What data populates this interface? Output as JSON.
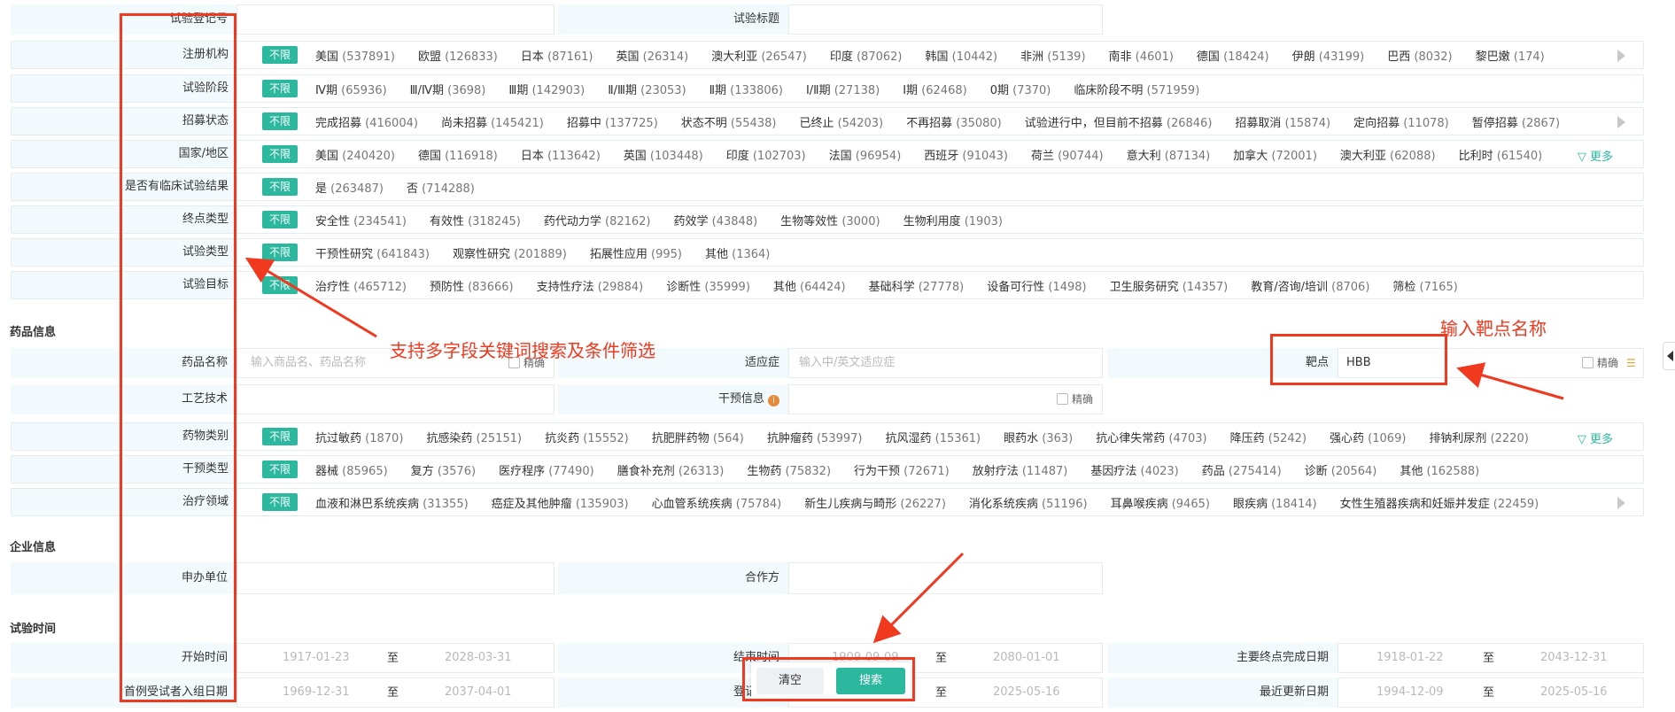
{
  "rows": {
    "reg_no": {
      "label": "试验登记号"
    },
    "trial_title": {
      "label": "试验标题"
    },
    "registry": {
      "label": "注册机构",
      "all": "不限",
      "options": [
        [
          "美国",
          "(537891)"
        ],
        [
          "欧盟",
          "(126833)"
        ],
        [
          "日本",
          "(87161)"
        ],
        [
          "英国",
          "(26314)"
        ],
        [
          "澳大利亚",
          "(26547)"
        ],
        [
          "印度",
          "(87062)"
        ],
        [
          "韩国",
          "(10442)"
        ],
        [
          "非洲",
          "(5139)"
        ],
        [
          "南非",
          "(4601)"
        ],
        [
          "德国",
          "(18424)"
        ],
        [
          "伊朗",
          "(43199)"
        ],
        [
          "巴西",
          "(8032)"
        ],
        [
          "黎巴嫩",
          "(174)"
        ]
      ]
    },
    "phase": {
      "label": "试验阶段",
      "all": "不限",
      "options": [
        [
          "Ⅳ期",
          "(65936)"
        ],
        [
          "Ⅲ/Ⅳ期",
          "(3698)"
        ],
        [
          "Ⅲ期",
          "(142903)"
        ],
        [
          "Ⅱ/Ⅲ期",
          "(23053)"
        ],
        [
          "Ⅱ期",
          "(133806)"
        ],
        [
          "Ⅰ/Ⅱ期",
          "(27138)"
        ],
        [
          "Ⅰ期",
          "(62468)"
        ],
        [
          "0期",
          "(7370)"
        ],
        [
          "临床阶段不明",
          "(571959)"
        ]
      ]
    },
    "recruit": {
      "label": "招募状态",
      "all": "不限",
      "options": [
        [
          "完成招募",
          "(416004)"
        ],
        [
          "尚未招募",
          "(145421)"
        ],
        [
          "招募中",
          "(137725)"
        ],
        [
          "状态不明",
          "(55438)"
        ],
        [
          "已终止",
          "(54203)"
        ],
        [
          "不再招募",
          "(35080)"
        ],
        [
          "试验进行中，但目前不招募",
          "(26846)"
        ],
        [
          "招募取消",
          "(15874)"
        ],
        [
          "定向招募",
          "(11078)"
        ],
        [
          "暂停招募",
          "(2867)"
        ]
      ]
    },
    "country": {
      "label": "国家/地区",
      "all": "不限",
      "more": "更多",
      "options": [
        [
          "美国",
          "(240420)"
        ],
        [
          "德国",
          "(116918)"
        ],
        [
          "日本",
          "(113642)"
        ],
        [
          "英国",
          "(103448)"
        ],
        [
          "印度",
          "(102703)"
        ],
        [
          "法国",
          "(96954)"
        ],
        [
          "西班牙",
          "(91043)"
        ],
        [
          "荷兰",
          "(90744)"
        ],
        [
          "意大利",
          "(87134)"
        ],
        [
          "加拿大",
          "(72001)"
        ],
        [
          "澳大利亚",
          "(62088)"
        ],
        [
          "比利时",
          "(61540)"
        ]
      ]
    },
    "has_result": {
      "label": "是否有临床试验结果",
      "all": "不限",
      "options": [
        [
          "是",
          "(263487)"
        ],
        [
          "否",
          "(714288)"
        ]
      ]
    },
    "endpoint": {
      "label": "终点类型",
      "all": "不限",
      "options": [
        [
          "安全性",
          "(234541)"
        ],
        [
          "有效性",
          "(318245)"
        ],
        [
          "药代动力学",
          "(82162)"
        ],
        [
          "药效学",
          "(43848)"
        ],
        [
          "生物等效性",
          "(3000)"
        ],
        [
          "生物利用度",
          "(1903)"
        ]
      ]
    },
    "trial_type": {
      "label": "试验类型",
      "all": "不限",
      "options": [
        [
          "干预性研究",
          "(641843)"
        ],
        [
          "观察性研究",
          "(201889)"
        ],
        [
          "拓展性应用",
          "(995)"
        ],
        [
          "其他",
          "(1364)"
        ]
      ]
    },
    "purpose": {
      "label": "试验目标",
      "all": "不限",
      "options": [
        [
          "治疗性",
          "(465712)"
        ],
        [
          "预防性",
          "(83666)"
        ],
        [
          "支持性疗法",
          "(29884)"
        ],
        [
          "诊断性",
          "(35999)"
        ],
        [
          "其他",
          "(64424)"
        ],
        [
          "基础科学",
          "(27778)"
        ],
        [
          "设备可行性",
          "(1498)"
        ],
        [
          "卫生服务研究",
          "(14357)"
        ],
        [
          "教育/咨询/培训",
          "(8706)"
        ],
        [
          "筛检",
          "(7165)"
        ]
      ]
    },
    "drug_class": {
      "label": "药物类别",
      "all": "不限",
      "more": "更多",
      "options": [
        [
          "抗过敏药",
          "(1870)"
        ],
        [
          "抗感染药",
          "(25151)"
        ],
        [
          "抗炎药",
          "(15552)"
        ],
        [
          "抗肥胖药物",
          "(564)"
        ],
        [
          "抗肿瘤药",
          "(53997)"
        ],
        [
          "抗风湿药",
          "(15361)"
        ],
        [
          "眼药水",
          "(363)"
        ],
        [
          "抗心律失常药",
          "(4703)"
        ],
        [
          "降压药",
          "(5242)"
        ],
        [
          "强心药",
          "(1069)"
        ],
        [
          "排钠利尿剂",
          "(2220)"
        ]
      ]
    },
    "intervention": {
      "label": "干预类型",
      "all": "不限",
      "options": [
        [
          "器械",
          "(85965)"
        ],
        [
          "复方",
          "(3576)"
        ],
        [
          "医疗程序",
          "(77490)"
        ],
        [
          "膳食补充剂",
          "(26313)"
        ],
        [
          "生物药",
          "(75832)"
        ],
        [
          "行为干预",
          "(72671)"
        ],
        [
          "放射疗法",
          "(11487)"
        ],
        [
          "基因疗法",
          "(4023)"
        ],
        [
          "药品",
          "(275414)"
        ],
        [
          "诊断",
          "(20564)"
        ],
        [
          "其他",
          "(162588)"
        ]
      ]
    },
    "therapy_area": {
      "label": "治疗领域",
      "all": "不限",
      "options": [
        [
          "血液和淋巴系统疾病",
          "(31355)"
        ],
        [
          "癌症及其他肿瘤",
          "(135903)"
        ],
        [
          "心血管系统疾病",
          "(75784)"
        ],
        [
          "新生儿疾病与畸形",
          "(26227)"
        ],
        [
          "消化系统疾病",
          "(51196)"
        ],
        [
          "耳鼻喉疾病",
          "(9465)"
        ],
        [
          "眼疾病",
          "(18414)"
        ],
        [
          "女性生殖器疾病和妊娠并发症",
          "(22459)"
        ]
      ]
    }
  },
  "sections": {
    "drug": "药品信息",
    "company": "企业信息",
    "time": "试验时间"
  },
  "drug": {
    "name_label": "药品名称",
    "name_placeholder": "输入商品名、药品名称",
    "exact": "精确",
    "indication_label": "适应症",
    "indication_placeholder": "输入中/英文适应症",
    "target_label": "靶点",
    "target_value": "HBB",
    "process_label": "工艺技术",
    "interv_info_label": "干预信息"
  },
  "company": {
    "sponsor_label": "申办单位",
    "partner_label": "合作方"
  },
  "time": {
    "start_label": "开始时间",
    "start_from": "1917-01-23",
    "start_to": "2028-03-31",
    "to": "至",
    "end_label": "结束时间",
    "end_from": "1909-09-09",
    "end_to": "2080-01-01",
    "primary_label": "主要终点完成日期",
    "primary_from": "1918-01-22",
    "primary_to": "2043-12-31",
    "first_label": "首例受试者入组日期",
    "first_from": "1969-12-31",
    "first_to": "2037-04-01",
    "reg_label": "登记日期",
    "reg_to": "2025-05-16",
    "update_label": "最近更新日期",
    "update_from": "1994-12-09",
    "update_to": "2025-05-16"
  },
  "buttons": {
    "clear": "清空",
    "search": "搜索"
  },
  "annotations": {
    "multi": "支持多字段关键词搜索及条件筛选",
    "target": "输入靶点名称"
  },
  "colors": {
    "accent": "#2bb89f",
    "label_bg": "#f2fafd",
    "annotation": "#f0391e"
  }
}
